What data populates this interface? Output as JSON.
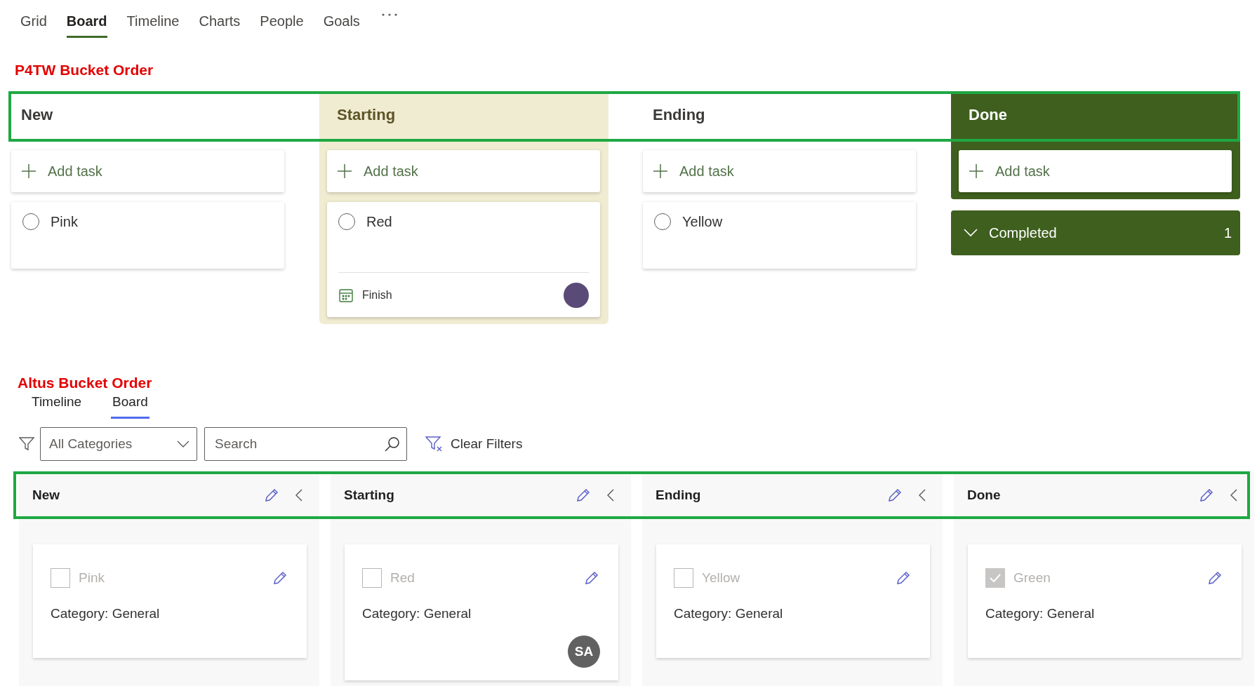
{
  "tabs": [
    {
      "label": "Grid",
      "selected": false
    },
    {
      "label": "Board",
      "selected": true
    },
    {
      "label": "Timeline",
      "selected": false
    },
    {
      "label": "Charts",
      "selected": false
    },
    {
      "label": "People",
      "selected": false
    },
    {
      "label": "Goals",
      "selected": false
    }
  ],
  "planner_board": {
    "title": "P4TW Bucket Order",
    "buckets": [
      {
        "name": "New",
        "kind": "plain",
        "add_label": "Add task",
        "tasks": [
          {
            "title": "Pink",
            "checked": false
          }
        ]
      },
      {
        "name": "Starting",
        "kind": "tinted",
        "add_label": "Add task",
        "tasks": [
          {
            "title": "Red",
            "checked": false,
            "due_label": "Finish",
            "has_assignee": true
          }
        ]
      },
      {
        "name": "Ending",
        "kind": "plain",
        "add_label": "Add task",
        "tasks": [
          {
            "title": "Yellow",
            "checked": false
          }
        ]
      },
      {
        "name": "Done",
        "kind": "dark",
        "add_label": "Add task",
        "completed": {
          "label": "Completed",
          "count": "1"
        }
      }
    ]
  },
  "altus_board": {
    "title": "Altus Bucket Order",
    "tabs": [
      {
        "label": "Timeline",
        "selected": false
      },
      {
        "label": "Board",
        "selected": true
      }
    ],
    "filters": {
      "category": "All Categories",
      "search_placeholder": "Search",
      "clear_label": "Clear Filters"
    },
    "buckets": [
      {
        "name": "New",
        "cards": [
          {
            "title": "Pink",
            "checked": false,
            "category": "Category: General"
          }
        ]
      },
      {
        "name": "Starting",
        "cards": [
          {
            "title": "Red",
            "checked": false,
            "category": "Category: General",
            "assignee": "SA"
          }
        ]
      },
      {
        "name": "Ending",
        "cards": [
          {
            "title": "Yellow",
            "checked": false,
            "category": "Category: General"
          }
        ]
      },
      {
        "name": "Done",
        "cards": [
          {
            "title": "Green",
            "checked": true,
            "category": "Category: General"
          }
        ]
      }
    ]
  }
}
